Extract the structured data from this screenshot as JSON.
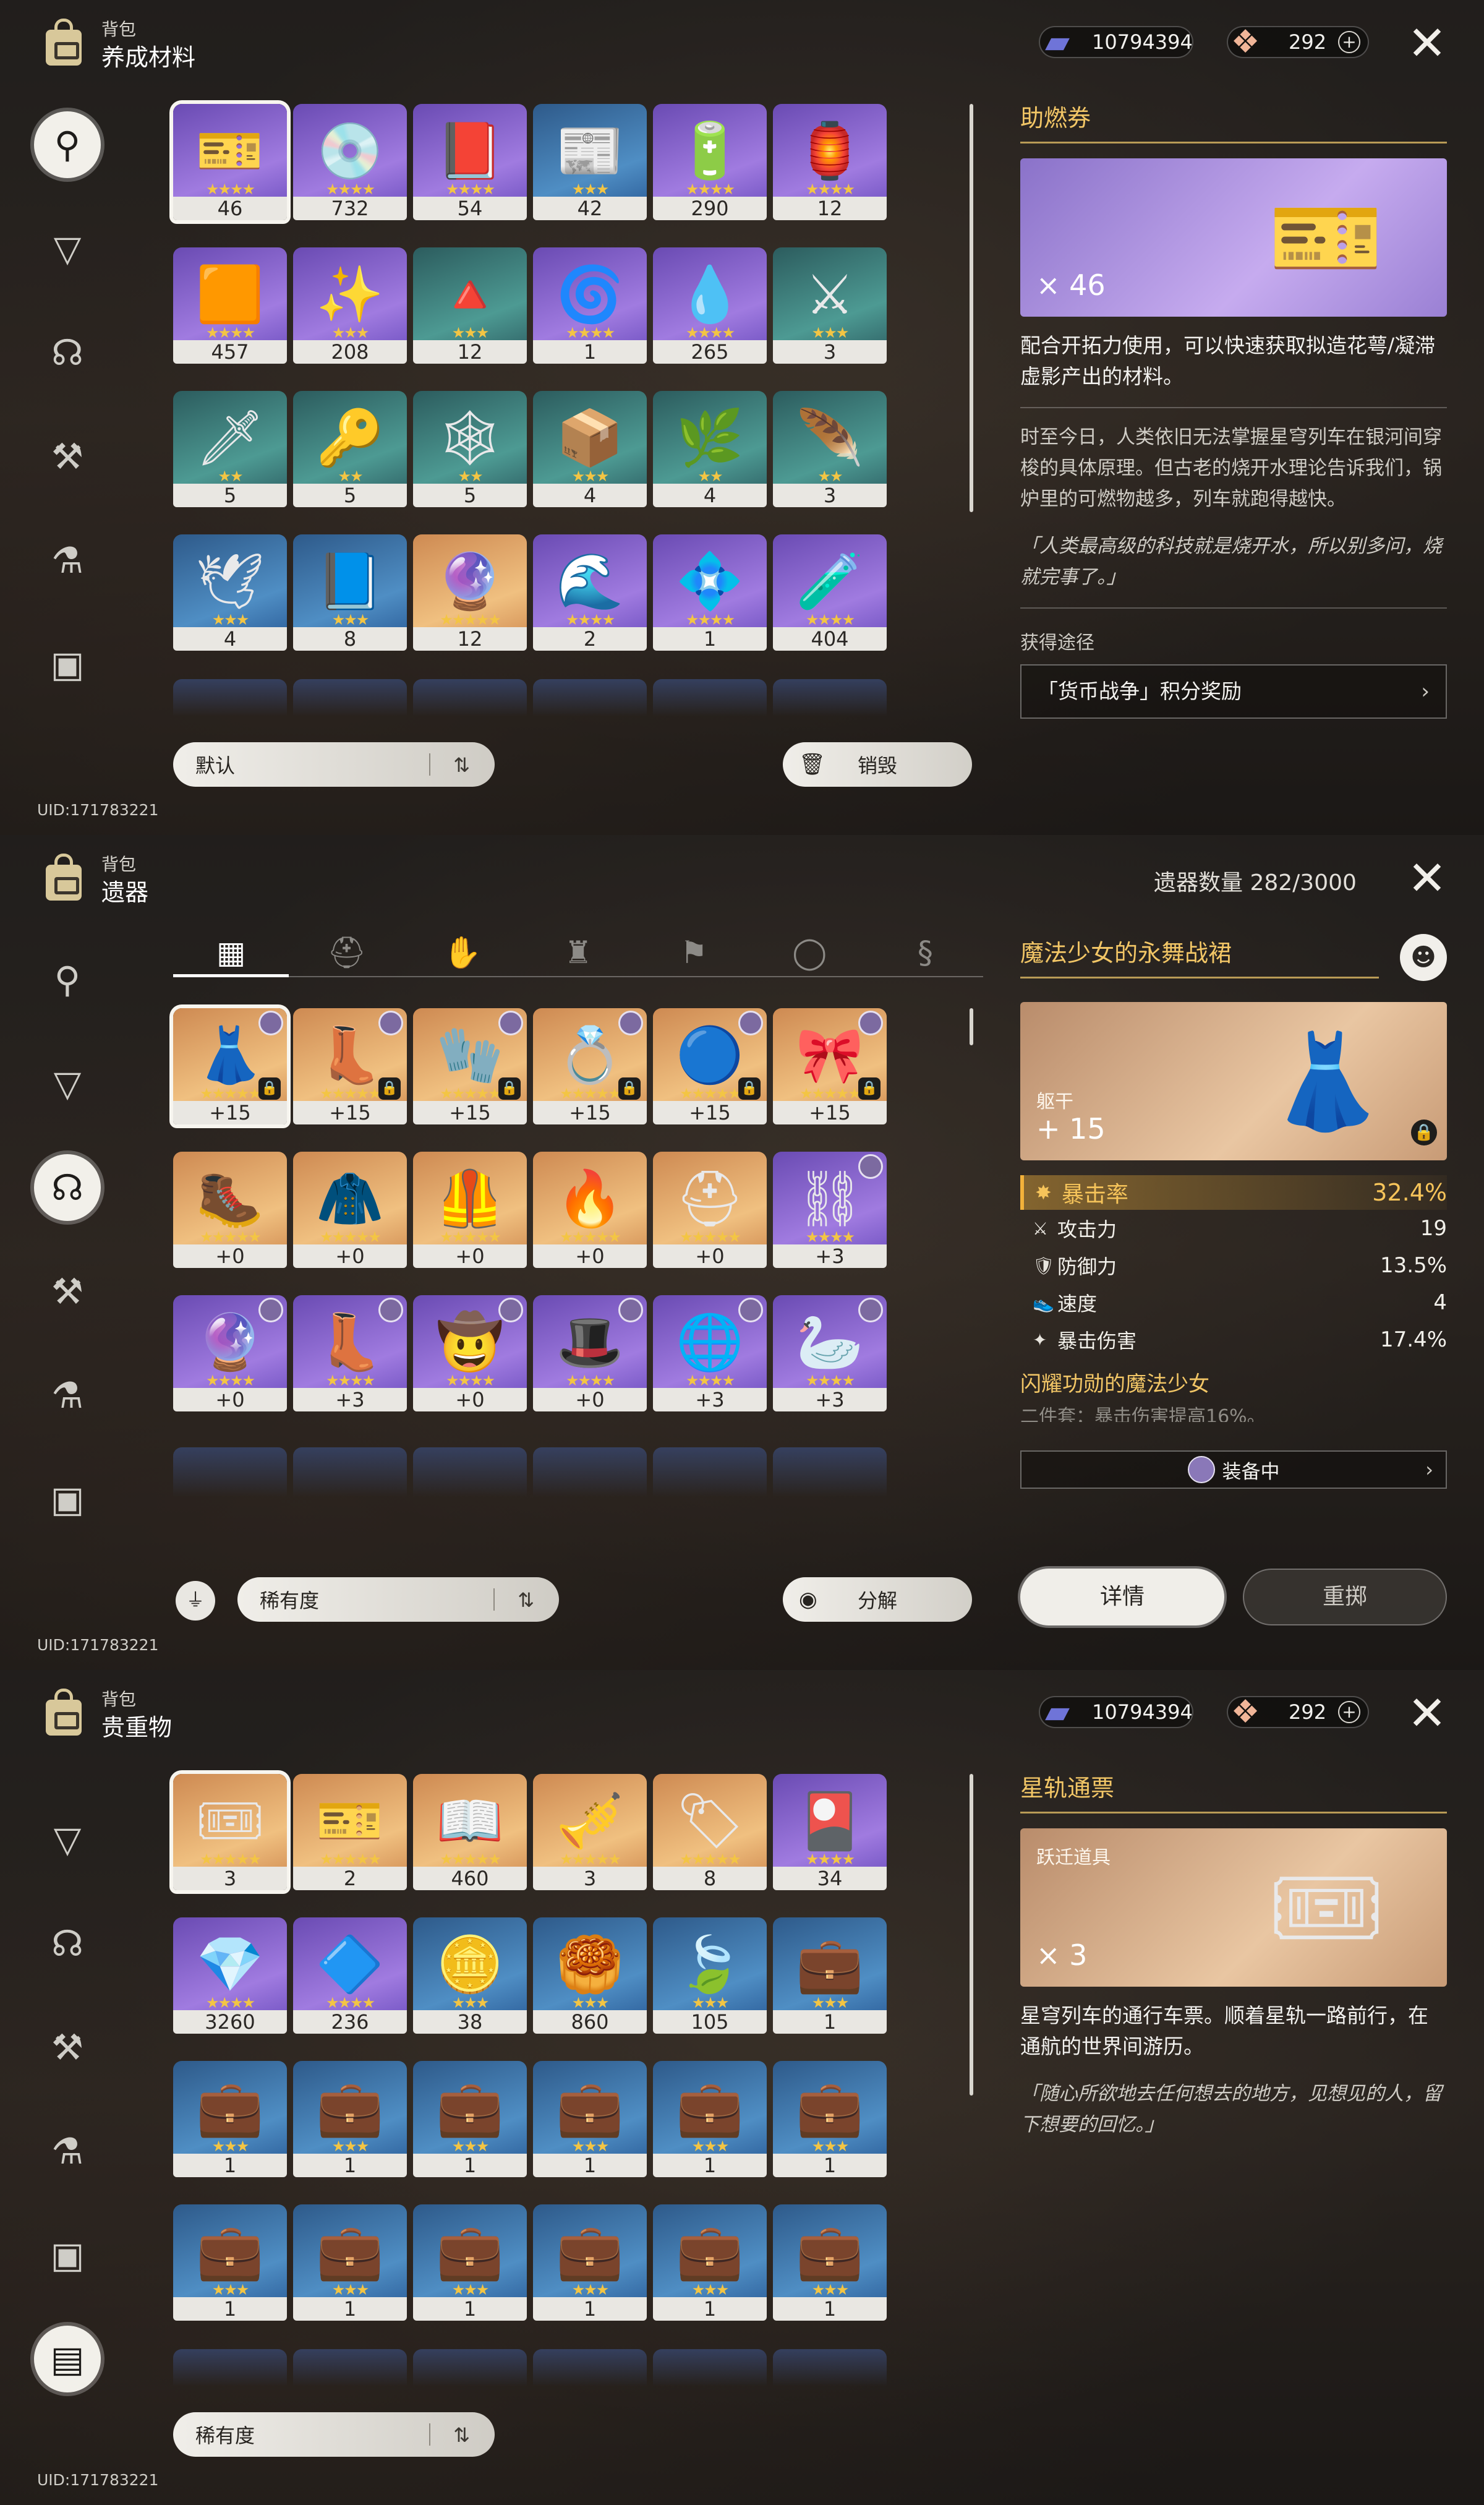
{
  "panels": {
    "materials": {
      "breadcrumb": "背包",
      "title": "养成材料",
      "currency": {
        "stellar_jade_pass": "10794394",
        "jade": "292",
        "plus": "+"
      },
      "items": [
        {
          "count": "46",
          "stars": "★★★★",
          "rarity": "r4",
          "icon": "🎫",
          "selected": true
        },
        {
          "count": "732",
          "stars": "★★★★",
          "rarity": "r4",
          "icon": "💿"
        },
        {
          "count": "54",
          "stars": "★★★★",
          "rarity": "r4",
          "icon": "📕"
        },
        {
          "count": "42",
          "stars": "★★★",
          "rarity": "r3",
          "icon": "📰"
        },
        {
          "count": "290",
          "stars": "★★★★",
          "rarity": "r4",
          "icon": "🔋"
        },
        {
          "count": "12",
          "stars": "★★★★",
          "rarity": "r4",
          "icon": "🏮"
        },
        {
          "count": "457",
          "stars": "★★★★",
          "rarity": "r4",
          "icon": "🟧"
        },
        {
          "count": "208",
          "stars": "★★★",
          "rarity": "r4",
          "icon": "✨"
        },
        {
          "count": "12",
          "stars": "★★★",
          "rarity": "r2",
          "icon": "🔺"
        },
        {
          "count": "1",
          "stars": "★★★★",
          "rarity": "r4",
          "icon": "🌀"
        },
        {
          "count": "265",
          "stars": "★★★★",
          "rarity": "r4",
          "icon": "💧"
        },
        {
          "count": "3",
          "stars": "★★★",
          "rarity": "r2",
          "icon": "⚔"
        },
        {
          "count": "5",
          "stars": "★★",
          "rarity": "r2",
          "icon": "🗡"
        },
        {
          "count": "5",
          "stars": "★★",
          "rarity": "r2",
          "icon": "🔑"
        },
        {
          "count": "5",
          "stars": "★★",
          "rarity": "r2",
          "icon": "🕸"
        },
        {
          "count": "4",
          "stars": "★★★",
          "rarity": "r2",
          "icon": "📦"
        },
        {
          "count": "4",
          "stars": "★★",
          "rarity": "r2",
          "icon": "🌿"
        },
        {
          "count": "3",
          "stars": "★★",
          "rarity": "r2",
          "icon": "🪶"
        },
        {
          "count": "4",
          "stars": "★★★",
          "rarity": "r3",
          "icon": "🕊"
        },
        {
          "count": "8",
          "stars": "★★★",
          "rarity": "r3",
          "icon": "📘"
        },
        {
          "count": "12",
          "stars": "★★★★★",
          "rarity": "r5",
          "icon": "🔮"
        },
        {
          "count": "2",
          "stars": "★★★★",
          "rarity": "r4",
          "icon": "🌊"
        },
        {
          "count": "1",
          "stars": "★★★★",
          "rarity": "r4",
          "icon": "💠"
        },
        {
          "count": "404",
          "stars": "★★★★",
          "rarity": "r4",
          "icon": "🧪"
        }
      ],
      "sort_label": "默认",
      "action_label": "销毁",
      "detail": {
        "name": "助燃券",
        "qty": "× 46",
        "usage": "配合开拓力使用，可以快速获取拟造花萼/凝滞虚影产出的材料。",
        "lore": "时至今日，人类依旧无法掌握星穹列车在银河间穿梭的具体原理。但古老的烧开水理论告诉我们，锅炉里的可燃物越多，列车就跑得越快。",
        "quote": "「人类最高级的科技就是烧开水，所以别多问，烧就完事了。」",
        "source_label": "获得途径",
        "source": "「货币战争」积分奖励"
      },
      "uid": "UID:171783221"
    },
    "relics": {
      "breadcrumb": "背包",
      "title": "遗器",
      "relic_count": "遗器数量 282/3000",
      "items": [
        {
          "count": "+15",
          "stars": "★★★★★",
          "rarity": "r5",
          "icon": "👗",
          "selected": true,
          "lock": true,
          "owner": true
        },
        {
          "count": "+15",
          "stars": "★★★★★",
          "rarity": "r5",
          "icon": "👢",
          "lock": true,
          "owner": true
        },
        {
          "count": "+15",
          "stars": "★★★★★",
          "rarity": "r5",
          "icon": "🧤",
          "lock": true,
          "owner": true
        },
        {
          "count": "+15",
          "stars": "★★★★★",
          "rarity": "r5",
          "icon": "💍",
          "lock": true,
          "owner": true
        },
        {
          "count": "+15",
          "stars": "★★★★★",
          "rarity": "r5",
          "icon": "🔵",
          "lock": true,
          "owner": true
        },
        {
          "count": "+15",
          "stars": "★★★★★",
          "rarity": "r5",
          "icon": "🎀",
          "lock": true,
          "owner": true
        },
        {
          "count": "+0",
          "stars": "★★★★★",
          "rarity": "r5",
          "icon": "🥾"
        },
        {
          "count": "+0",
          "stars": "★★★★★",
          "rarity": "r5",
          "icon": "🧥"
        },
        {
          "count": "+0",
          "stars": "★★★★★",
          "rarity": "r5",
          "icon": "🦺"
        },
        {
          "count": "+0",
          "stars": "★★★★★",
          "rarity": "r5",
          "icon": "🔥"
        },
        {
          "count": "+0",
          "stars": "★★★★★",
          "rarity": "r5",
          "icon": "⛑"
        },
        {
          "count": "+3",
          "stars": "★★★★",
          "rarity": "r4",
          "icon": "⛓",
          "owner": true
        },
        {
          "count": "+0",
          "stars": "★★★★",
          "rarity": "r4",
          "icon": "🔮",
          "owner": true
        },
        {
          "count": "+3",
          "stars": "★★★★",
          "rarity": "r4",
          "icon": "👢",
          "owner": true
        },
        {
          "count": "+0",
          "stars": "★★★★",
          "rarity": "r4",
          "icon": "🤠",
          "owner": true
        },
        {
          "count": "+0",
          "stars": "★★★★",
          "rarity": "r4",
          "icon": "🎩",
          "owner": true
        },
        {
          "count": "+3",
          "stars": "★★★★",
          "rarity": "r4",
          "icon": "🌐",
          "owner": true
        },
        {
          "count": "+3",
          "stars": "★★★★",
          "rarity": "r4",
          "icon": "🦢",
          "owner": true
        }
      ],
      "sort_label": "稀有度",
      "action_label": "分解",
      "detail": {
        "name": "魔法少女的永舞战裙",
        "sub": "躯干",
        "level": "+ 15",
        "main_stat": {
          "name": "暴击率",
          "value": "32.4%"
        },
        "sub_stats": [
          {
            "name": "攻击力",
            "value": "19",
            "icon": "⚔"
          },
          {
            "name": "防御力",
            "value": "13.5%",
            "icon": "🛡"
          },
          {
            "name": "速度",
            "value": "4",
            "icon": "👟"
          },
          {
            "name": "暴击伤害",
            "value": "17.4%",
            "icon": "✦"
          }
        ],
        "set_name": "闪耀功勋的魔法少女",
        "set_desc": "二件套：暴击伤害提高16%。",
        "equipped": "装备中",
        "btn_detail": "详情",
        "btn_reroll": "重掷"
      },
      "uid": "UID:171783221"
    },
    "valuables": {
      "breadcrumb": "背包",
      "title": "贵重物",
      "currency": {
        "stellar_jade_pass": "10794394",
        "jade": "292",
        "plus": "+"
      },
      "items": [
        {
          "count": "3",
          "stars": "★★★★★",
          "rarity": "r5",
          "icon": "🎟",
          "selected": true
        },
        {
          "count": "2",
          "stars": "★★★★★",
          "rarity": "r5",
          "icon": "🎫"
        },
        {
          "count": "460",
          "stars": "★★★★★",
          "rarity": "r5",
          "icon": "📖"
        },
        {
          "count": "3",
          "stars": "★★★★★",
          "rarity": "r5",
          "icon": "🎺"
        },
        {
          "count": "8",
          "stars": "★★★★★",
          "rarity": "r5",
          "icon": "🏷"
        },
        {
          "count": "34",
          "stars": "★★★★",
          "rarity": "r4",
          "icon": "🎴"
        },
        {
          "count": "3260",
          "stars": "★★★★",
          "rarity": "r4",
          "icon": "💎"
        },
        {
          "count": "236",
          "stars": "★★★★",
          "rarity": "r4",
          "icon": "🔷"
        },
        {
          "count": "38",
          "stars": "★★★",
          "rarity": "r3",
          "icon": "🪙"
        },
        {
          "count": "860",
          "stars": "★★★",
          "rarity": "r3",
          "icon": "🥮"
        },
        {
          "count": "105",
          "stars": "★★★",
          "rarity": "r3",
          "icon": "🍃"
        },
        {
          "count": "1",
          "stars": "★★★",
          "rarity": "r3",
          "icon": "💼"
        },
        {
          "count": "1",
          "stars": "★★★",
          "rarity": "r3",
          "icon": "💼"
        },
        {
          "count": "1",
          "stars": "★★★",
          "rarity": "r3",
          "icon": "💼"
        },
        {
          "count": "1",
          "stars": "★★★",
          "rarity": "r3",
          "icon": "💼"
        },
        {
          "count": "1",
          "stars": "★★★",
          "rarity": "r3",
          "icon": "💼"
        },
        {
          "count": "1",
          "stars": "★★★",
          "rarity": "r3",
          "icon": "💼"
        },
        {
          "count": "1",
          "stars": "★★★",
          "rarity": "r3",
          "icon": "💼"
        },
        {
          "count": "1",
          "stars": "★★★",
          "rarity": "r3",
          "icon": "💼"
        },
        {
          "count": "1",
          "stars": "★★★",
          "rarity": "r3",
          "icon": "💼"
        },
        {
          "count": "1",
          "stars": "★★★",
          "rarity": "r3",
          "icon": "💼"
        },
        {
          "count": "1",
          "stars": "★★★",
          "rarity": "r3",
          "icon": "💼"
        },
        {
          "count": "1",
          "stars": "★★★",
          "rarity": "r3",
          "icon": "💼"
        },
        {
          "count": "1",
          "stars": "★★★",
          "rarity": "r3",
          "icon": "💼"
        }
      ],
      "sort_label": "稀有度",
      "detail": {
        "name": "星轨通票",
        "sub": "跃迁道具",
        "qty": "× 3",
        "usage": "星穹列车的通行车票。顺着星轨一路前行，在通航的世界间游历。",
        "quote": "「随心所欲地去任何想去的地方，见想见的人，留下想要的回忆。」"
      },
      "uid": "UID:171783221"
    }
  },
  "nav_icons": [
    "materials-icon",
    "light-cone-icon",
    "relic-icon",
    "upgrade-icon",
    "consumable-icon",
    "mission-icon",
    "valuables-icon"
  ],
  "sort_toggle_glyph": "⇅",
  "close_glyph": "✕",
  "chevron_glyph": "›",
  "colors": {
    "accent_gold": "#f2c666",
    "main_stat": "#f6c45a",
    "lock_green": "#5fd86a"
  }
}
